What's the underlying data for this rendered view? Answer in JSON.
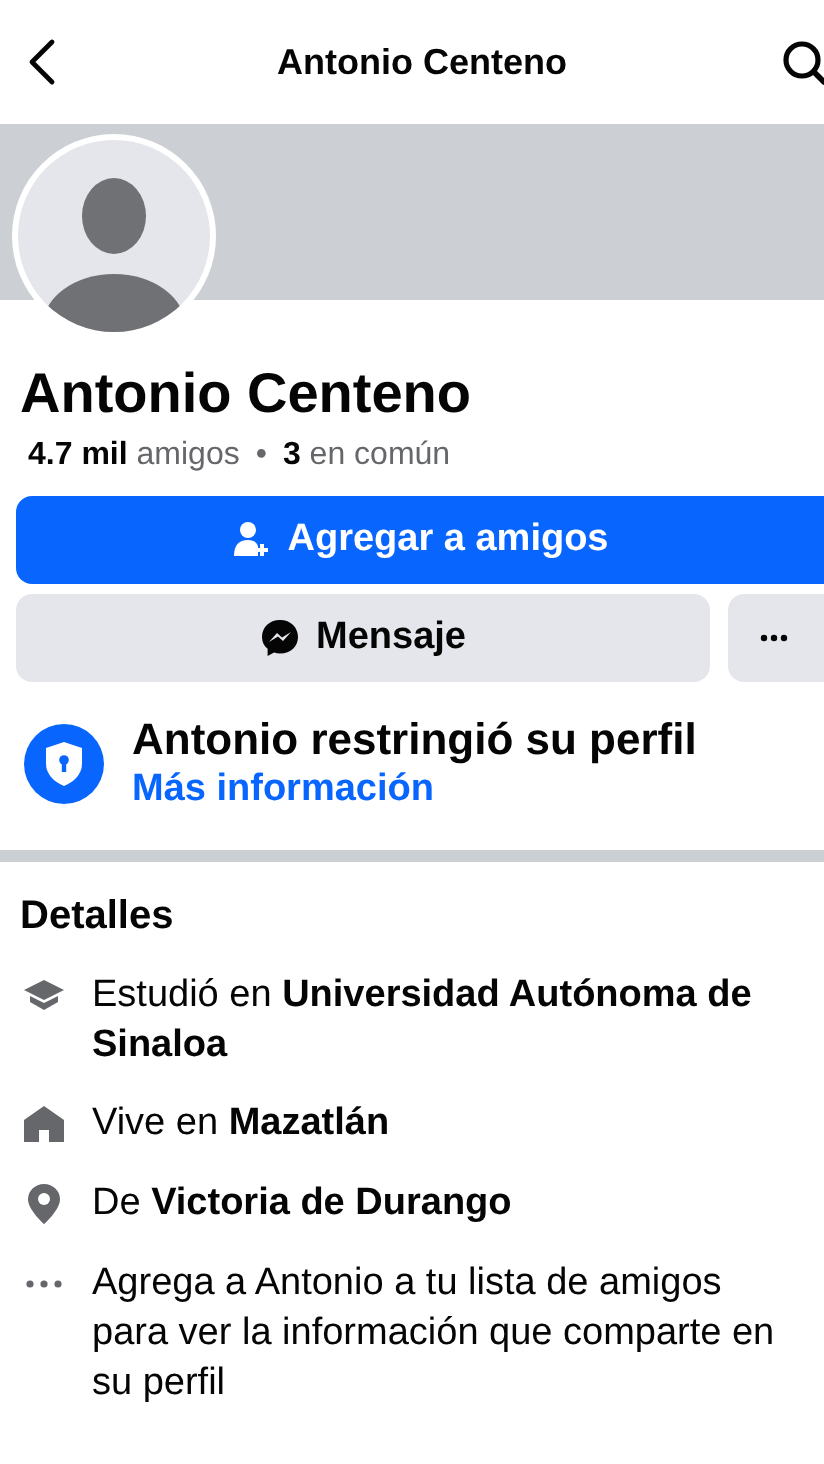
{
  "header": {
    "title": "Antonio Centeno"
  },
  "profile": {
    "name": "Antonio Centeno",
    "friends": "**4.7 mil** amigos",
    "separator": "•",
    "mutual": "**3** en común"
  },
  "actions": {
    "add_friend": "Agregar a amigos",
    "message": "Mensaje"
  },
  "restriction": {
    "title": "Antonio restringió su perfil",
    "link": "Más información"
  },
  "details": {
    "title": "Detalles",
    "items": [
      {
        "kind": "education",
        "text": "Estudió en **Universidad Autónoma de Sinaloa**"
      },
      {
        "kind": "home",
        "text": "Vive en **Mazatlán**"
      },
      {
        "kind": "place",
        "text": "De **Victoria de Durango**"
      },
      {
        "kind": "more",
        "text": "Agrega a Antonio a tu lista de amigos para ver la información que comparte en su perfil"
      }
    ]
  }
}
